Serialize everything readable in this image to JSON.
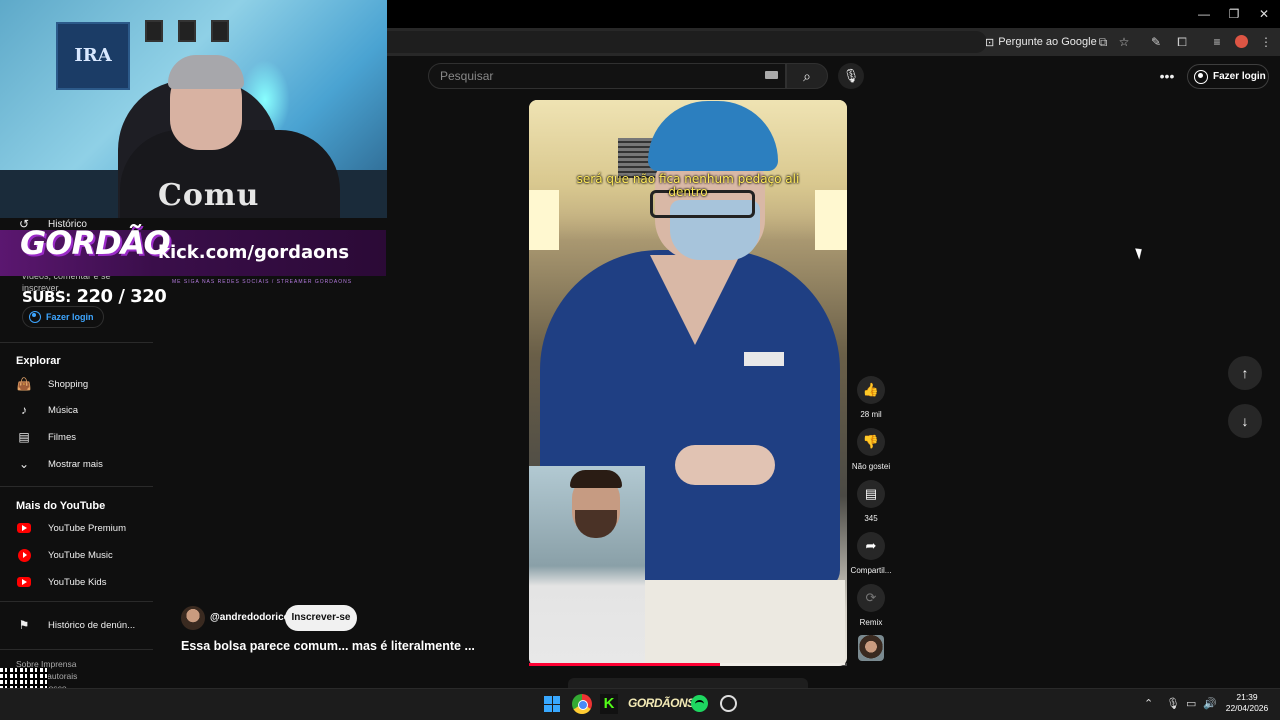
{
  "browser": {
    "ask_google": "Pergunte ao Google"
  },
  "youtube": {
    "search_placeholder": "Pesquisar",
    "login_label": "Fazer login"
  },
  "stream_overlay": {
    "banner_logo": "GORDÃO",
    "banner_url": "kick.com/gordaons",
    "banner_tagline": "ME SIGA NAS REDES SOCIAIS / STREAMER GORDAONS",
    "subs_label": "SUBS:",
    "subs_value": "220 / 320",
    "poster_text": "IRA",
    "shirt_text": "Comu"
  },
  "sidebar": {
    "history_label": "Histórico",
    "login_hint": "vídeos, comentar e se inscrever.",
    "login_button": "Fazer login",
    "explore_heading": "Explorar",
    "explore_items": [
      {
        "label": "Shopping",
        "icon": "shopping-bag-icon"
      },
      {
        "label": "Música",
        "icon": "music-note-icon"
      },
      {
        "label": "Filmes",
        "icon": "film-icon"
      },
      {
        "label": "Mostrar mais",
        "icon": "chevron-down-icon"
      }
    ],
    "more_heading": "Mais do YouTube",
    "more_items": [
      {
        "label": "YouTube Premium",
        "icon": "youtube-premium-icon"
      },
      {
        "label": "YouTube Music",
        "icon": "youtube-music-icon"
      },
      {
        "label": "YouTube Kids",
        "icon": "youtube-kids-icon"
      }
    ],
    "report_history": "Histórico de denún...",
    "footer_line1": "Sobre  Imprensa",
    "footer_line2": "Direitos autorais",
    "footer_line3": "Fale conosco"
  },
  "short": {
    "caption": "será que não fica nenhum pedaço ali dentro",
    "progress": 0.6,
    "channel_handle": "@andredodorico",
    "subscribe_label": "Inscrever-se",
    "title": "Essa bolsa parece comum... mas é literalmente ..."
  },
  "actions": {
    "likes": "28 mil",
    "dislike_label": "Não gostei",
    "comments": "345",
    "share_label": "Compartil...",
    "remix_label": "Remix"
  },
  "taskbar": {
    "gordao_label": "GORDÃONS",
    "time": "21:39",
    "date": "22/04/2026"
  },
  "colors": {
    "accent_red": "#ff0033",
    "link_blue": "#3ea6ff",
    "caption_yellow": "#ffea5a"
  }
}
